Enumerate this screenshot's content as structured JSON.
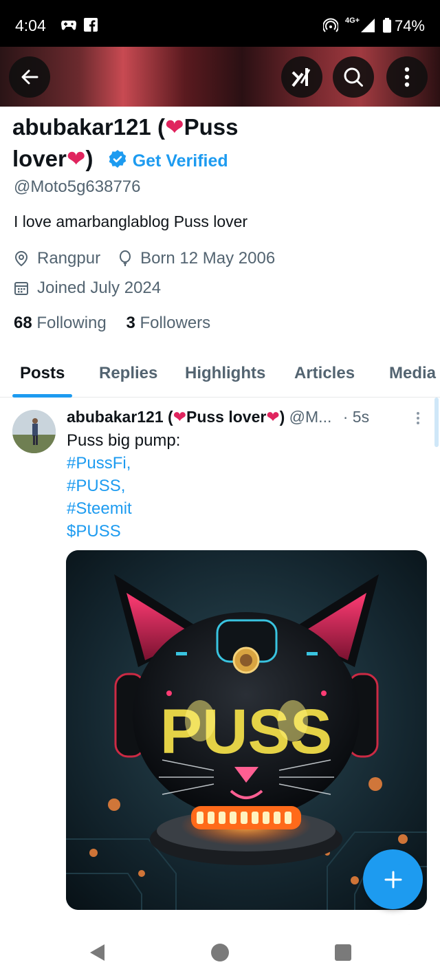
{
  "status_bar": {
    "time": "4:04",
    "network": "4G+",
    "battery": "74%"
  },
  "profile": {
    "name_part1": "abubakar121 (",
    "name_part2": "Puss",
    "name_part3": "lover",
    "name_part4": ")",
    "get_verified": "Get Verified",
    "handle": "@Moto5g638776",
    "bio": "I love amarbanglablog  Puss lover",
    "location": "Rangpur",
    "birthday": "Born 12 May 2006",
    "joined": "Joined July 2024",
    "following_count": "68",
    "following_label": "Following",
    "followers_count": "3",
    "followers_label": "Followers"
  },
  "tabs": [
    "Posts",
    "Replies",
    "Highlights",
    "Articles",
    "Media"
  ],
  "post": {
    "author_part1": "abubakar121 (",
    "author_part2": "Puss lover",
    "author_part3": ")",
    "handle": "@M...",
    "time": "· 5s",
    "text": "Puss big pump:",
    "tags": [
      "#PussFi,",
      "#PUSS,",
      "#Steemit",
      "$PUSS"
    ],
    "image_text": "PUSS"
  },
  "colors": {
    "accent": "#1d9bf0",
    "heart": "#e0245e",
    "text": "#0f1419",
    "muted": "#536471"
  }
}
